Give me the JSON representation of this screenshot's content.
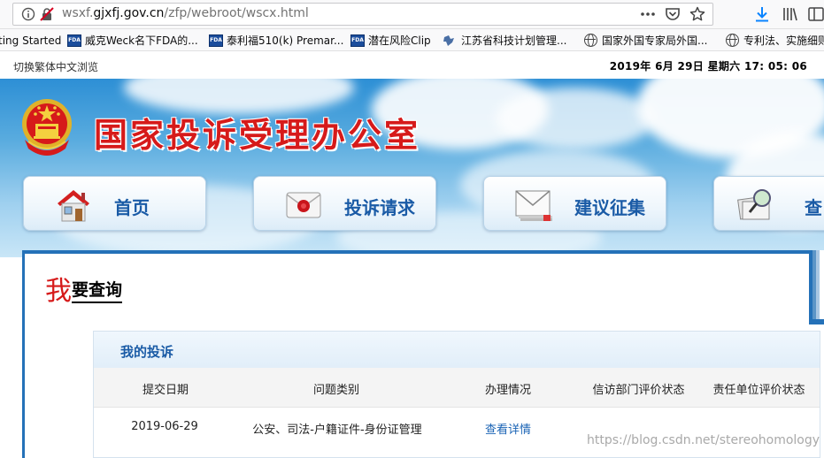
{
  "browser": {
    "url_prefix": "wsxf.",
    "url_domain": "gjxfj.gov.cn",
    "url_path": "/zfp/webroot/wscx.html",
    "bookmarks": [
      {
        "label": "ting Started",
        "icon": "none"
      },
      {
        "label": "威克Weck名下FDA的...",
        "icon": "fda-icon"
      },
      {
        "label": "泰利福510(k) Premar...",
        "icon": "fda-icon"
      },
      {
        "label": "潜在风险Clip",
        "icon": "fda-icon"
      },
      {
        "label": "江苏省科技计划管理...",
        "icon": "puzzle-icon"
      },
      {
        "label": "国家外国专家局外国...",
        "icon": "globe-icon"
      },
      {
        "label": "专利法、实施细则",
        "icon": "globe-icon"
      }
    ]
  },
  "site": {
    "traditional_link": "切换繁体中文浏览",
    "datetime": "2019年 6月 29日 星期六 17: 05: 06",
    "title": "国家投诉受理办公室",
    "nav": [
      {
        "label": "首页",
        "icon": "house-icon"
      },
      {
        "label": "投诉请求",
        "icon": "envelope-seal-icon"
      },
      {
        "label": "建议征集",
        "icon": "mail-stack-icon"
      },
      {
        "label": "查",
        "icon": "search-docs-icon"
      }
    ]
  },
  "query": {
    "title_big": "我",
    "title_rest": "要查询"
  },
  "complaints": {
    "title": "我的投诉",
    "columns": [
      "提交日期",
      "问题类别",
      "办理情况",
      "信访部门评价状态",
      "责任单位评价状态"
    ],
    "rows": [
      {
        "date": "2019-06-29",
        "category": "公安、司法-户籍证件-身份证管理",
        "status": "查看详情",
        "dept_eval": "",
        "unit_eval": ""
      }
    ]
  },
  "watermark": "https://blog.csdn.net/stereohomology"
}
